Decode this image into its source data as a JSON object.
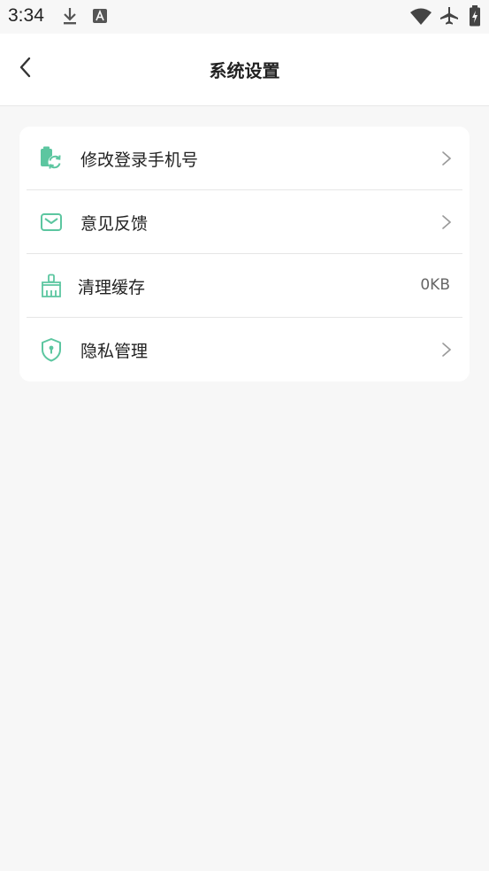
{
  "status_bar": {
    "time": "3:34",
    "icons": [
      "download-icon",
      "a-badge-icon",
      "wifi-icon",
      "airplane-icon",
      "battery-icon"
    ]
  },
  "header": {
    "title": "系统设置",
    "back_icon": "back-chevron-icon"
  },
  "settings": {
    "items": [
      {
        "label": "修改登录手机号",
        "icon": "phone-change-icon",
        "trailing": "chevron"
      },
      {
        "label": "意见反馈",
        "icon": "mail-icon",
        "trailing": "chevron"
      },
      {
        "label": "清理缓存",
        "icon": "broom-icon",
        "trailing": "value",
        "value": "0KB"
      },
      {
        "label": "隐私管理",
        "icon": "shield-lock-icon",
        "trailing": "chevron"
      }
    ]
  },
  "colors": {
    "accent": "#5cc6a0",
    "background": "#f7f7f7",
    "card": "#ffffff"
  }
}
